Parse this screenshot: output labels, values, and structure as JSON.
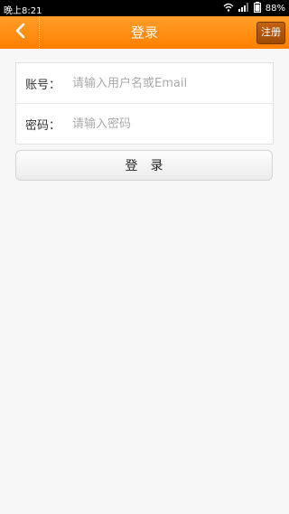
{
  "status_bar": {
    "time": "晚上8:21",
    "battery": "88%",
    "icons": [
      "wifi-icon",
      "signal-icon",
      "battery-icon"
    ]
  },
  "top_bar": {
    "back_icon": "chevron-left-icon",
    "title": "登录",
    "register_label": "注册",
    "colors": {
      "bar": "#ff8a14",
      "register": "#a24c08"
    }
  },
  "form": {
    "account": {
      "label": "账号：",
      "placeholder": "请输入用户名或Email",
      "value": ""
    },
    "password": {
      "label": "密码：",
      "placeholder": "请输入密码",
      "value": ""
    }
  },
  "login_button": {
    "label": "登录"
  }
}
